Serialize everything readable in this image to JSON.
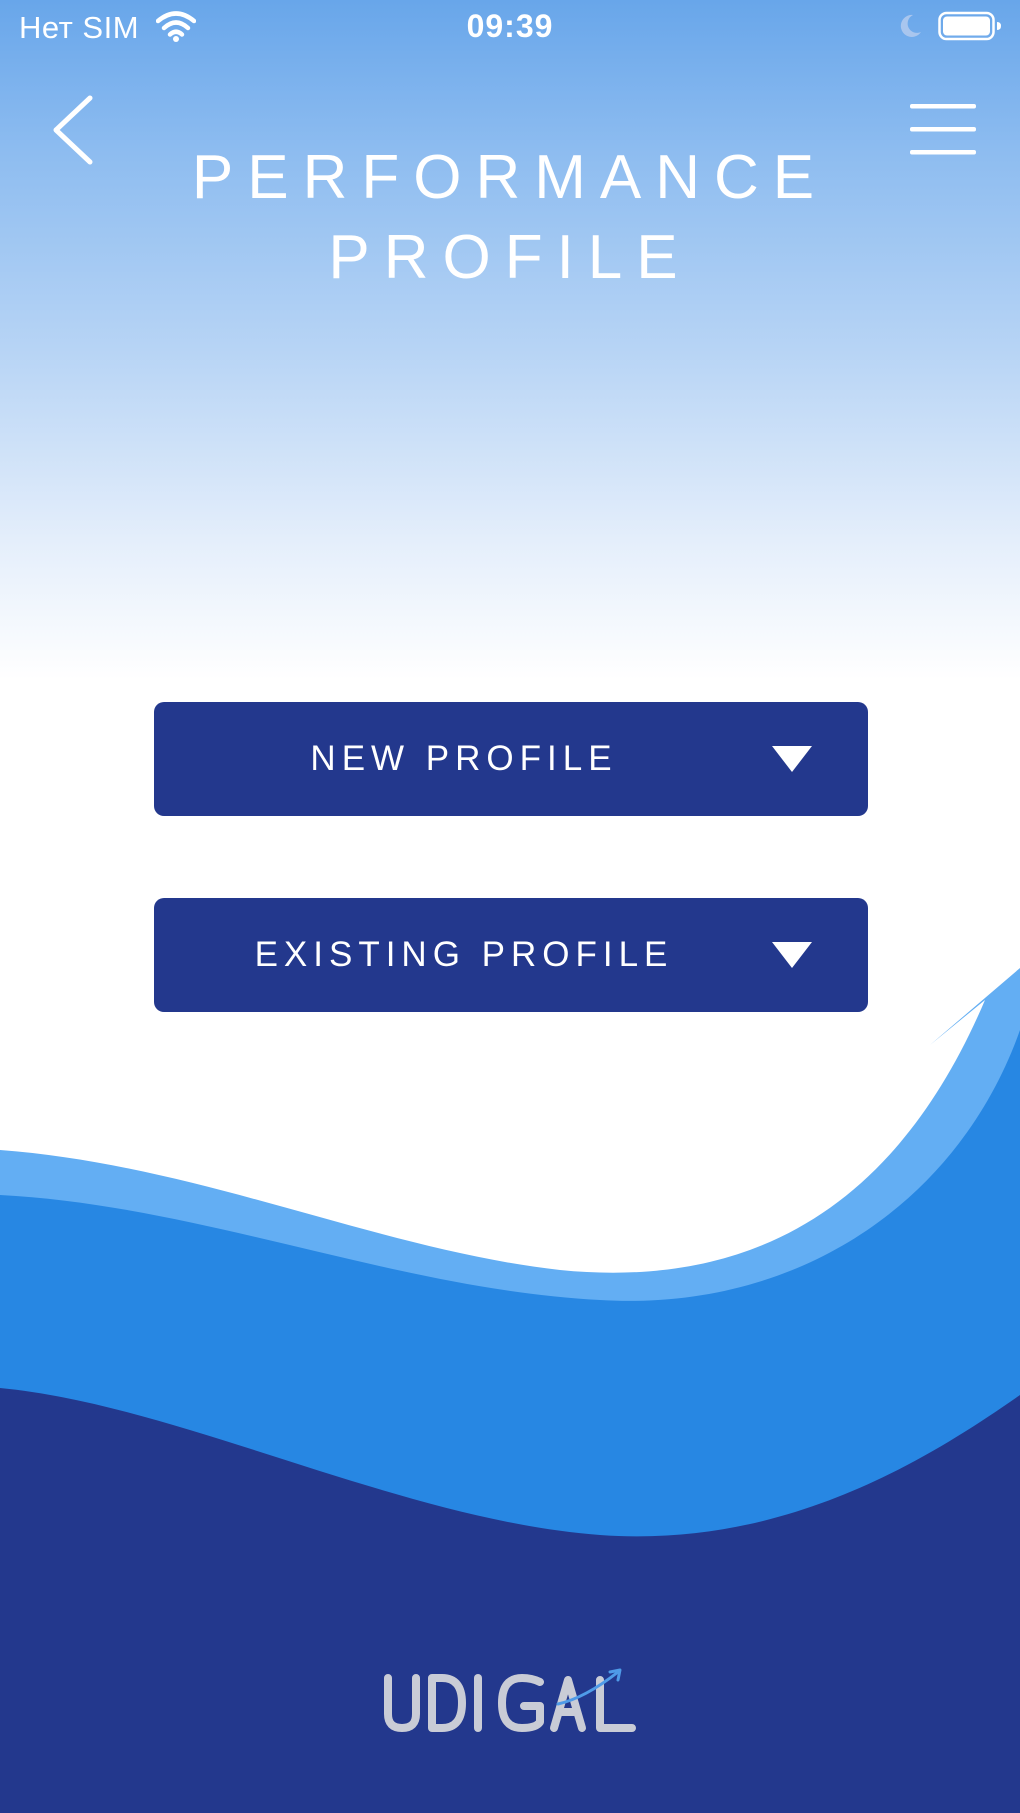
{
  "status_bar": {
    "carrier": "Нет SIM",
    "time": "09:39",
    "icons": [
      "wifi-icon",
      "moon-icon",
      "battery-icon"
    ]
  },
  "header": {
    "back_icon": "chevron-left-icon",
    "menu_icon": "hamburger-menu-icon",
    "title_line1": "PERFORMANCE",
    "title_line2": "PROFILE"
  },
  "main": {
    "buttons": [
      {
        "label": "NEW PROFILE",
        "icon": "caret-down-icon"
      },
      {
        "label": "EXISTING PROFILE",
        "icon": "caret-down-icon"
      }
    ]
  },
  "footer": {
    "logo_text": "UDI GAL"
  },
  "colors": {
    "sky_top": "#68a6ea",
    "button_bg": "#23388d",
    "wave_light": "#63aef3",
    "wave_mid": "#2787e3",
    "wave_dark": "#23388d",
    "logo": "#c9ccd6"
  }
}
